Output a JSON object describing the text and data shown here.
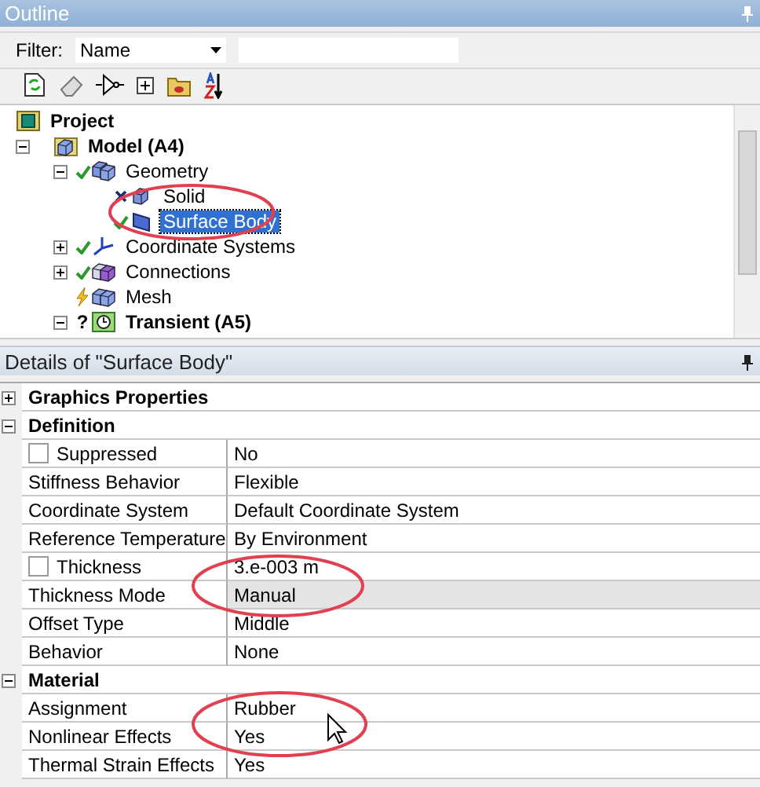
{
  "outline": {
    "title": "Outline",
    "filter": {
      "label": "Filter:",
      "value": "Name"
    },
    "tree": [
      {
        "label": "Project",
        "kind": "project",
        "selected": false,
        "children": [
          {
            "label": "Model (A4)",
            "kind": "model",
            "expanded": true,
            "selected": false,
            "children": [
              {
                "label": "Geometry",
                "kind": "geometry",
                "status": {
                  "kind": "ok"
                },
                "expanded": true,
                "selected": false,
                "children": [
                  {
                    "label": "Solid",
                    "kind": "solid",
                    "status": {
                      "kind": "error"
                    },
                    "selected": false
                  },
                  {
                    "label": "Surface Body",
                    "kind": "surface",
                    "status": {
                      "kind": "ok"
                    },
                    "selected": true
                  }
                ]
              },
              {
                "label": "Coordinate Systems",
                "kind": "coordinates",
                "status": {
                  "kind": "ok"
                },
                "expanded": false,
                "selected": false
              },
              {
                "label": "Connections",
                "kind": "connections",
                "status": {
                  "kind": "ok"
                },
                "expanded": false,
                "selected": false
              },
              {
                "label": "Mesh",
                "kind": "mesh",
                "status": {
                  "kind": "pending"
                },
                "selected": false
              },
              {
                "label": "Transient (A5)",
                "kind": "transient",
                "status": {
                  "kind": "unknown",
                  "mark": "?"
                },
                "expanded": true,
                "selected": false
              }
            ]
          }
        ]
      }
    ]
  },
  "details": {
    "title": "Details of \"Surface Body\"",
    "groups": [
      {
        "label": "Graphics Properties",
        "expanded": false
      },
      {
        "label": "Definition",
        "expanded": true,
        "rows": [
          {
            "name": "Suppressed",
            "value": "No",
            "checked": false,
            "selected": false
          },
          {
            "name": "Stiffness Behavior",
            "value": "Flexible",
            "selected": false
          },
          {
            "name": "Coordinate System",
            "value": "Default Coordinate System",
            "selected": false
          },
          {
            "name": "Reference Temperature",
            "value": "By Environment",
            "selected": false
          },
          {
            "name": "Thickness",
            "value": "3.e-003 m",
            "checked": false,
            "selected": false
          },
          {
            "name": "Thickness Mode",
            "value": "Manual",
            "selected": true
          },
          {
            "name": "Offset Type",
            "value": "Middle",
            "selected": false
          },
          {
            "name": "Behavior",
            "value": "None",
            "selected": false
          }
        ]
      },
      {
        "label": "Material",
        "expanded": true,
        "rows": [
          {
            "name": "Assignment",
            "value": "Rubber",
            "selected": false
          },
          {
            "name": "Nonlinear Effects",
            "value": "Yes",
            "selected": false
          },
          {
            "name": "Thermal Strain Effects",
            "value": "Yes",
            "selected": false
          }
        ]
      }
    ]
  }
}
